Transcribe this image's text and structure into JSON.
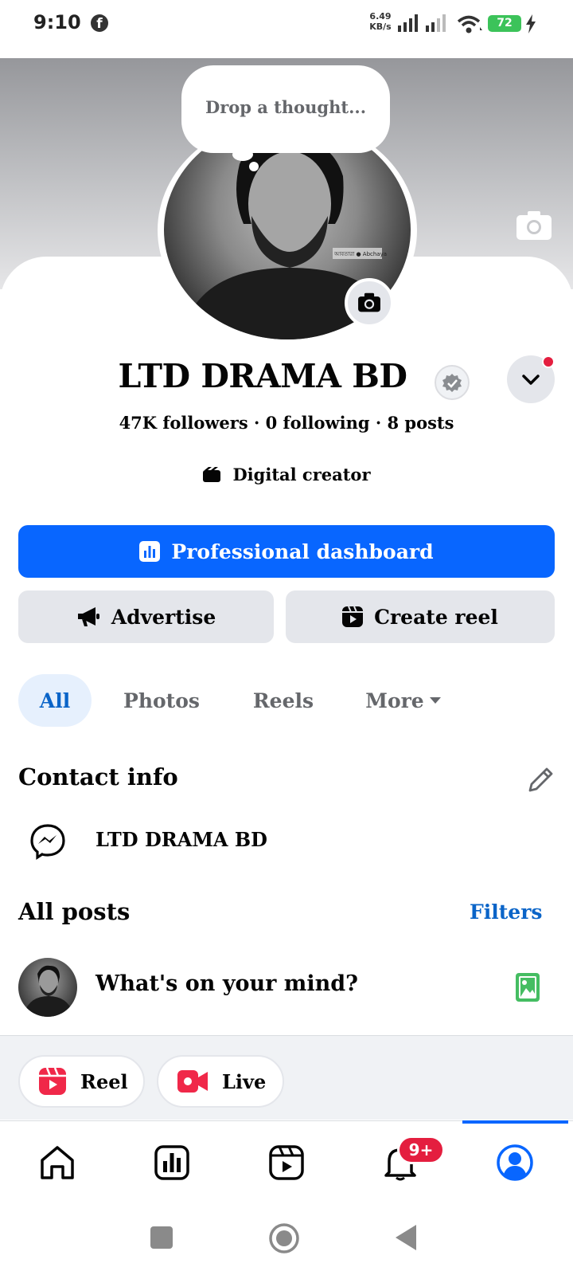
{
  "status_bar": {
    "time": "9:10",
    "app_icon": "f",
    "net_speed_value": "6.49",
    "net_speed_unit": "KB/s",
    "battery": "72"
  },
  "thought_bubble": {
    "placeholder": "Drop a thought..."
  },
  "profile": {
    "name": "LTD DRAMA BD",
    "stats": "47K followers · 0 following · 8 posts",
    "category": "Digital creator",
    "watermark": "আবতারা ● Abchaya"
  },
  "actions": {
    "pro_dashboard": "Professional dashboard",
    "advertise": "Advertise",
    "create_reel": "Create reel"
  },
  "tabs": [
    "All",
    "Photos",
    "Reels",
    "More"
  ],
  "contact": {
    "heading": "Contact info",
    "messenger": "LTD DRAMA BD"
  },
  "posts": {
    "heading": "All posts",
    "filters": "Filters",
    "composer_prompt": "What's on your mind?"
  },
  "create_strip": {
    "reel": "Reel",
    "live": "Live"
  },
  "nav": {
    "notifications_badge": "9+",
    "active": "profile"
  },
  "colors": {
    "accent": "#0866ff",
    "link": "#0a64c8",
    "badge_red": "#e41e3f",
    "button_gray": "#e4e6eb",
    "photo_green": "#45bd62"
  },
  "icons": [
    "facebook-icon",
    "signal-icon",
    "wifi-icon",
    "battery-icon",
    "camera-icon",
    "verified-icon",
    "chevron-down-icon",
    "chart-icon",
    "megaphone-icon",
    "reel-icon",
    "clapper-icon",
    "pencil-icon",
    "messenger-icon",
    "photo-icon",
    "live-video-icon",
    "home-icon",
    "dashboard-icon",
    "reels-icon",
    "bell-icon",
    "profile-icon"
  ]
}
